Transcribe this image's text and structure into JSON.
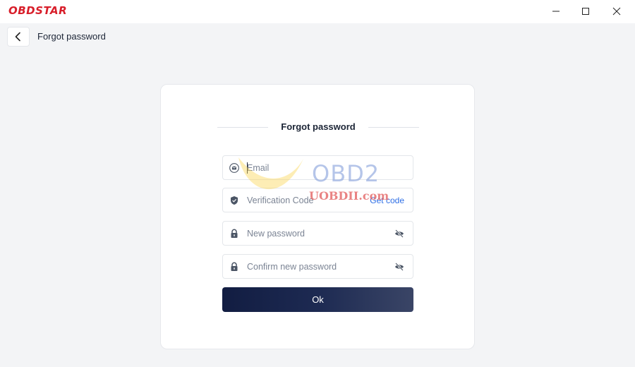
{
  "app": {
    "logo_text": "OBDSTAR"
  },
  "header": {
    "title": "Forgot password"
  },
  "card": {
    "title": "Forgot password",
    "email_placeholder": "Email",
    "code_placeholder": "Verification Code",
    "get_code_label": "Get code",
    "new_password_placeholder": "New password",
    "confirm_password_placeholder": "Confirm new password",
    "ok_label": "Ok"
  },
  "watermark": {
    "brand": "OBD2",
    "site": "UOBDII.com"
  },
  "colors": {
    "brand_red": "#d81e2a",
    "link_blue": "#2f6fe6",
    "button_dark": "#121d42",
    "background": "#f3f4f6"
  },
  "icons": {
    "email": "mail-icon",
    "code": "shield-icon",
    "password": "lock-icon",
    "toggle": "eye-off-icon"
  }
}
